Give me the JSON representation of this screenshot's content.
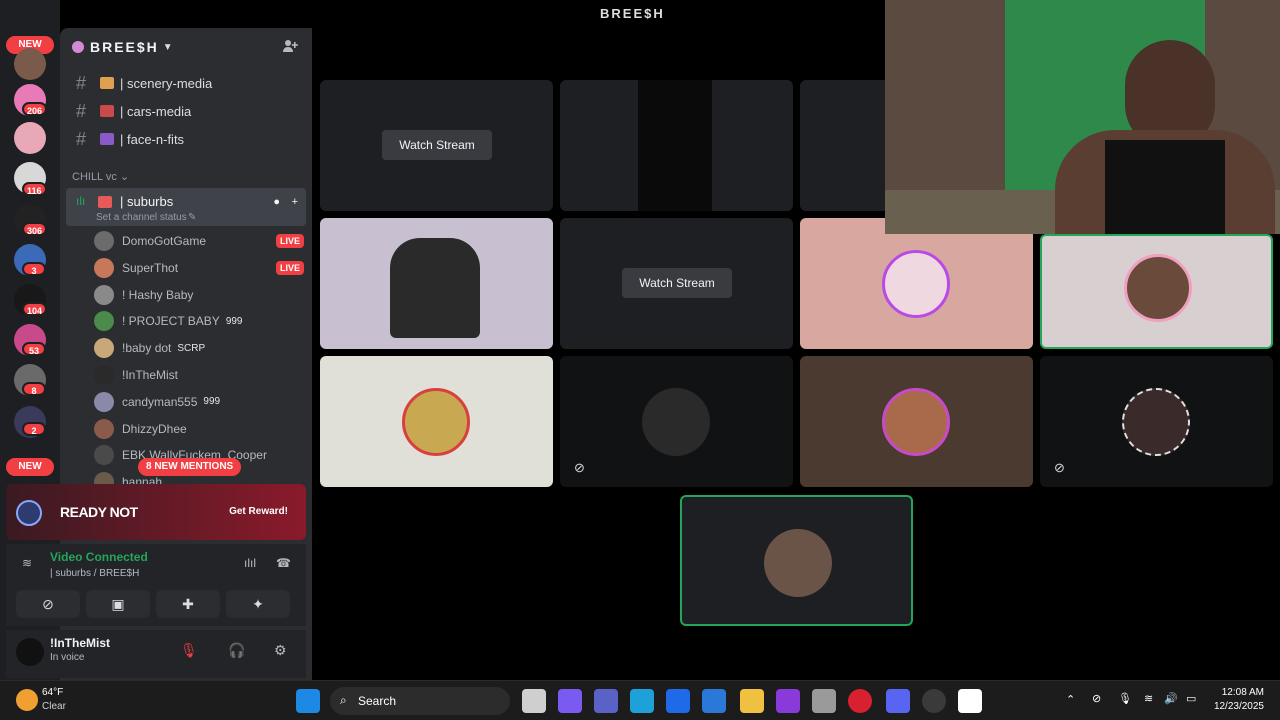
{
  "server": {
    "name": "BREE$H",
    "stage_title": "BREE$H"
  },
  "channels": [
    {
      "label": "| scenery-media",
      "emoji_color": "#e0a050"
    },
    {
      "label": "| cars-media",
      "emoji_color": "#c84a4a"
    },
    {
      "label": "| face-n-fits",
      "emoji_color": "#8a5ac8"
    }
  ],
  "category": "CHILL vc",
  "voice_channel": {
    "label": "| suburbs",
    "status_placeholder": "Set a channel status"
  },
  "members": [
    {
      "name": "DomoGotGame",
      "live": "LIVE",
      "color": "#6b6b6b"
    },
    {
      "name": "SuperThot",
      "live": "LIVE",
      "color": "#c8785a"
    },
    {
      "name": "! Hashy Baby",
      "tag": "",
      "color": "#8a8a8a"
    },
    {
      "name": "! PROJECT BABY",
      "tag": "999",
      "color": "#4a8a4a"
    },
    {
      "name": "!baby dot",
      "tag": "SCRP",
      "color": "#c8a878"
    },
    {
      "name": "!InTheMist",
      "tag": "",
      "color": "#2a2a2a"
    },
    {
      "name": "candyman555",
      "tag": "999",
      "color": "#8a8aa8"
    },
    {
      "name": "DhizzyDhee",
      "tag": "",
      "color": "#8a5a4a"
    },
    {
      "name": "EBK WallyFuckem_Cooper",
      "tag": "",
      "color": "#4a4a4a"
    },
    {
      "name": "hannah",
      "tag": "",
      "color": "#6a5a4a"
    }
  ],
  "mentions_label": "8 NEW MENTIONS",
  "rail": {
    "new_top": "NEW",
    "new_bottom": "NEW",
    "badges": [
      "206",
      "116",
      "306",
      "3",
      "104",
      "53",
      "8",
      "2"
    ]
  },
  "promo": {
    "title": "READY NOT",
    "cta": "Get Reward!"
  },
  "voice_panel": {
    "status": "Video Connected",
    "channel": "| suburbs / BREE$H"
  },
  "user": {
    "name": "!InTheMist",
    "status": "In voice"
  },
  "stage": {
    "watch_label": "Watch Stream"
  },
  "taskbar": {
    "temp": "64°F",
    "weather": "Clear",
    "search_label": "Search",
    "time": "12:08 AM",
    "date": "12/23/2025"
  },
  "colors": {
    "accent_green": "#23a55a",
    "danger": "#f23f43",
    "sidebar": "#2b2d31"
  }
}
